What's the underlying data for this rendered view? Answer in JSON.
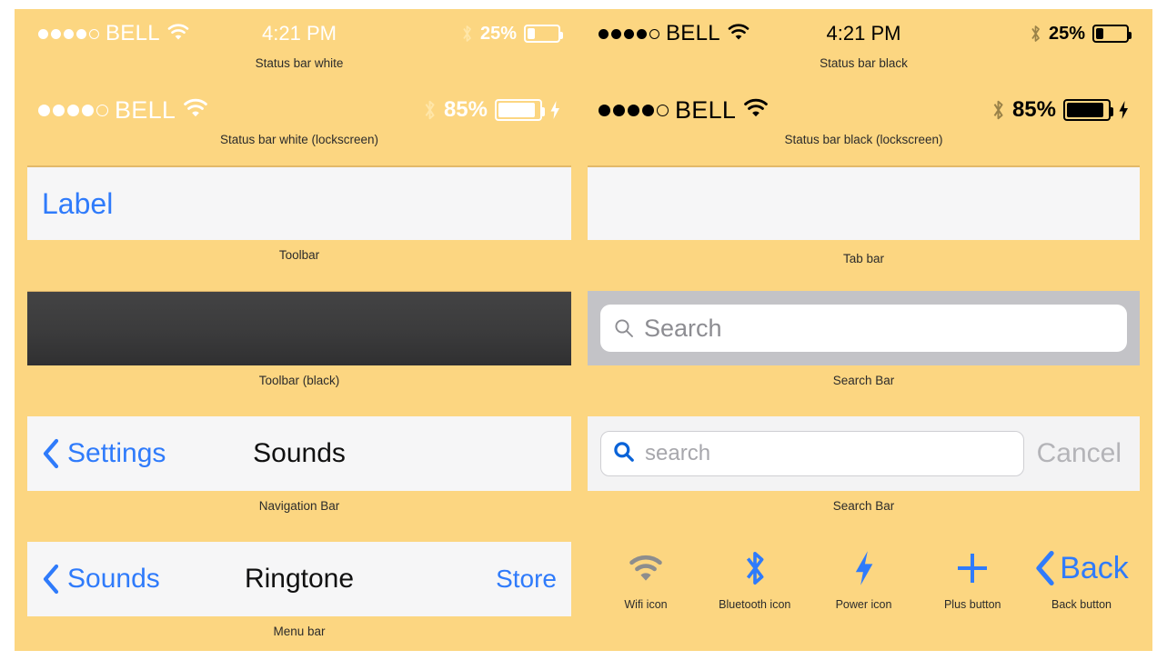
{
  "page": {
    "background_color": "#fcd681",
    "accent_blue": "#2f7bfb",
    "gray": "#8d8d92"
  },
  "status_bars": [
    {
      "id": "status-bar-white",
      "caption": "Status bar white",
      "theme": "white",
      "carrier": "BELL",
      "signal_dots_filled": 4,
      "signal_dots_total": 5,
      "wifi": "wifi-icon",
      "time": "4:21 PM",
      "bluetooth": "bluetooth-icon",
      "battery_percent": "25%",
      "battery_level": 25,
      "charging": false,
      "lockscreen": false
    },
    {
      "id": "status-bar-black",
      "caption": "Status bar black",
      "theme": "black",
      "carrier": "BELL",
      "signal_dots_filled": 4,
      "signal_dots_total": 5,
      "wifi": "wifi-icon",
      "time": "4:21 PM",
      "bluetooth": "bluetooth-icon",
      "battery_percent": "25%",
      "battery_level": 25,
      "charging": false,
      "lockscreen": false
    },
    {
      "id": "status-bar-white-lockscreen",
      "caption": "Status bar white (lockscreen)",
      "theme": "white",
      "carrier": "BELL",
      "signal_dots_filled": 4,
      "signal_dots_total": 5,
      "wifi": "wifi-icon",
      "time": "",
      "bluetooth": "bluetooth-icon",
      "battery_percent": "85%",
      "battery_level": 85,
      "charging": true,
      "lockscreen": true
    },
    {
      "id": "status-bar-black-lockscreen",
      "caption": "Status bar black (lockscreen)",
      "theme": "black",
      "carrier": "BELL",
      "signal_dots_filled": 4,
      "signal_dots_total": 5,
      "wifi": "wifi-icon",
      "time": "",
      "bluetooth": "bluetooth-icon",
      "battery_percent": "85%",
      "battery_level": 85,
      "charging": true,
      "lockscreen": true
    }
  ],
  "toolbar": {
    "caption": "Toolbar",
    "label": "Label"
  },
  "toolbar_black": {
    "caption": "Toolbar (black)"
  },
  "tab_bar": {
    "caption": "Tab bar"
  },
  "search_bar_plain": {
    "caption": "Search Bar",
    "placeholder": "Search",
    "icon": "search-icon"
  },
  "search_bar_cancel": {
    "caption": "Search Bar",
    "placeholder": "search",
    "icon": "search-icon",
    "cancel_label": "Cancel"
  },
  "navigation_bar": {
    "caption": "Navigation Bar",
    "back_label": "Settings",
    "title": "Sounds"
  },
  "menu_bar": {
    "caption": "Menu bar",
    "back_label": "Sounds",
    "title": "Ringtone",
    "right_label": "Store"
  },
  "icons": [
    {
      "name": "wifi-icon",
      "caption": "Wifi icon",
      "color": "#8d8d8d"
    },
    {
      "name": "bluetooth-icon",
      "caption": "Bluetooth icon",
      "color": "#2f7bfb"
    },
    {
      "name": "power-icon",
      "caption": "Power icon",
      "color": "#2f7bfb"
    },
    {
      "name": "plus-icon",
      "caption": "Plus button",
      "color": "#2f7bfb"
    },
    {
      "name": "back-icon",
      "caption": "Back button",
      "color": "#2f7bfb",
      "label": "Back"
    }
  ]
}
